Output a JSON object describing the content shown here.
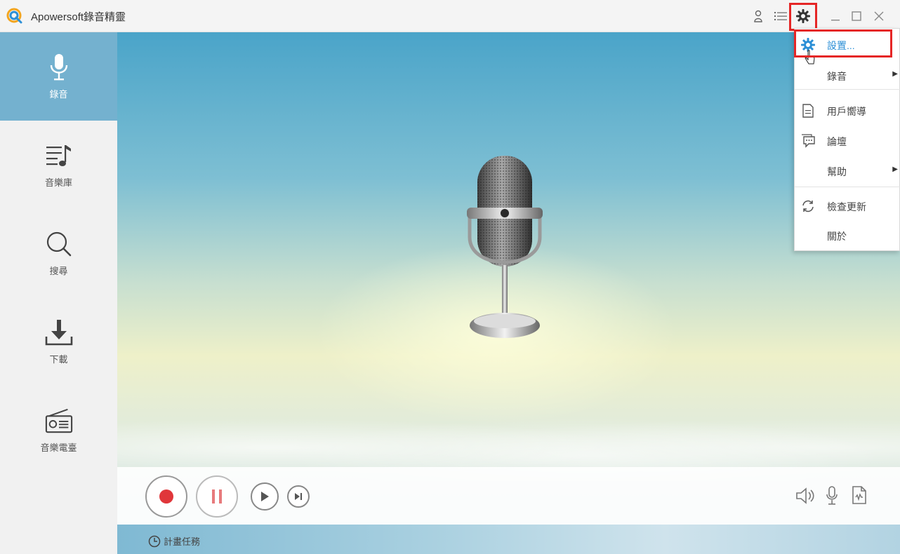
{
  "window": {
    "title": "Apowersoft錄音精靈"
  },
  "sidebar": {
    "items": [
      {
        "label": "錄音",
        "icon": "microphone-icon"
      },
      {
        "label": "音樂庫",
        "icon": "music-library-icon"
      },
      {
        "label": "搜尋",
        "icon": "search-icon"
      },
      {
        "label": "下載",
        "icon": "download-icon"
      },
      {
        "label": "音樂電臺",
        "icon": "radio-icon"
      }
    ]
  },
  "controls": {
    "schedule_label": "計畫任務"
  },
  "menu": {
    "settings": "設置...",
    "recording": "錄音",
    "user_guide": "用戶嚮導",
    "forum": "論壇",
    "help": "幫助",
    "check_update": "檢查更新",
    "about": "關於"
  },
  "colors": {
    "accent": "#74b1cf",
    "record_red": "#e0363a",
    "highlight": "#e52626"
  }
}
